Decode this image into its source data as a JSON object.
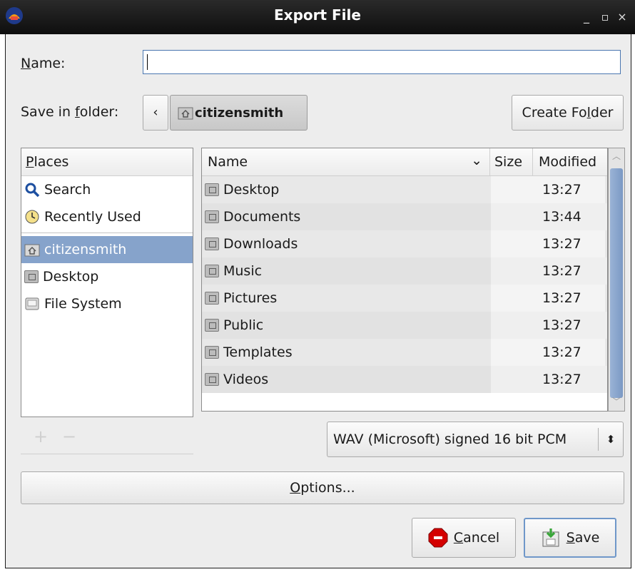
{
  "window": {
    "title": "Export File",
    "minimize_glyph": "_",
    "maximize_glyph": "▫",
    "close_glyph": "×",
    "app_icon": "audacity-icon"
  },
  "name_field": {
    "label": "Name:",
    "value": "",
    "placeholder": ""
  },
  "save_in": {
    "label": "Save in folder:",
    "back_glyph": "‹",
    "current_folder": "citizensmith",
    "create_folder_label": "Create Folder"
  },
  "places": {
    "header": "Places",
    "items": [
      {
        "label": "Search",
        "icon": "magnifier-icon",
        "selected": false
      },
      {
        "label": "Recently Used",
        "icon": "clock-icon",
        "selected": false
      },
      {
        "label": "citizensmith",
        "icon": "home-folder-icon",
        "selected": true
      },
      {
        "label": "Desktop",
        "icon": "desktop-folder-icon",
        "selected": false
      },
      {
        "label": "File System",
        "icon": "drive-icon",
        "selected": false
      }
    ],
    "add_glyph": "+",
    "remove_glyph": "−"
  },
  "files": {
    "columns": {
      "name": "Name",
      "sort_glyph": "⌄",
      "size": "Size",
      "modified": "Modified"
    },
    "rows": [
      {
        "name": "Desktop",
        "modified": "13:27"
      },
      {
        "name": "Documents",
        "modified": "13:44"
      },
      {
        "name": "Downloads",
        "modified": "13:27"
      },
      {
        "name": "Music",
        "modified": "13:27"
      },
      {
        "name": "Pictures",
        "modified": "13:27"
      },
      {
        "name": "Public",
        "modified": "13:27"
      },
      {
        "name": "Templates",
        "modified": "13:27"
      },
      {
        "name": "Videos",
        "modified": "13:27"
      }
    ]
  },
  "format": {
    "selected": "WAV (Microsoft) signed 16 bit PCM",
    "arrow_glyph": "⬍"
  },
  "buttons": {
    "options": "Options...",
    "cancel": "Cancel",
    "save": "Save"
  },
  "colors": {
    "selection": "#86a3cb",
    "focus_border": "#4a76b0",
    "titlebar": "#141414",
    "cancel_red": "#d40000",
    "save_green": "#3aa63a"
  }
}
